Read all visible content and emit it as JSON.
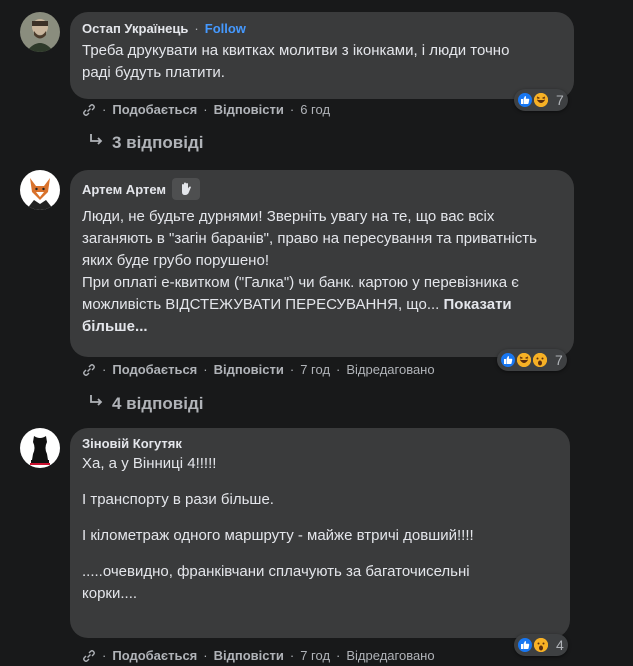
{
  "comments": [
    {
      "author": "Остап Українець",
      "follow_label": "Follow",
      "text_lines": [
        "Треба друкувати на квитках молитви з іконками, і люди точно раді будуть платити."
      ],
      "reactions": {
        "icons": [
          "like-icon",
          "haha-icon"
        ],
        "count": "7"
      },
      "actions": {
        "like": "Подобається",
        "reply": "Відповісти",
        "time": "6 год"
      },
      "replies_label": "3 відповіді"
    },
    {
      "author": "Артем Артем",
      "text_lines": [
        "Люди, не будьте дурнями! Зверніть увагу на те, що вас всіх заганяють в \"загін баранів\", право на пересування та приватність яких буде грубо порушено!",
        "При оплаті е-квитком (\"Галка\") чи банк. картою у перевізника є можливість ВІДСТЕЖУВАТИ ПЕРЕСУВАННЯ, що..."
      ],
      "see_more": "Показати більше...",
      "reactions": {
        "icons": [
          "like-icon",
          "haha-icon",
          "wow-icon"
        ],
        "count": "7"
      },
      "actions": {
        "like": "Подобається",
        "reply": "Відповісти",
        "time": "7 год",
        "edited": "Відредаговано"
      },
      "replies_label": "4 відповіді"
    },
    {
      "author": "Зіновій Когутяк",
      "paragraphs": [
        "Ха, а у Вінниці 4!!!!!",
        "І транспорту в рази більше.",
        "І кілометраж одного маршруту - майже втричі довший!!!!",
        ".....очевидно, франківчани сплачують за багаточисельні корки...."
      ],
      "reactions": {
        "icons": [
          "like-icon",
          "wow-icon"
        ],
        "count": "4"
      },
      "actions": {
        "like": "Подобається",
        "reply": "Відповісти",
        "time": "7 год",
        "edited": "Відредаговано"
      }
    }
  ],
  "separator": "·",
  "colors": {
    "background": "#18191a",
    "bubble": "#3a3b3c",
    "accent": "#4599ff",
    "like": "#1877f2",
    "emoji": "#f7b125"
  }
}
